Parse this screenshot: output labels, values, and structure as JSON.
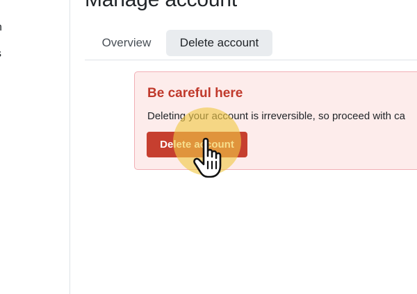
{
  "sidebar": {
    "items": [
      {
        "label": "n"
      },
      {
        "label": "s"
      }
    ]
  },
  "page": {
    "title": "Manage account"
  },
  "tabs": [
    {
      "label": "Overview",
      "active": false
    },
    {
      "label": "Delete account",
      "active": true
    }
  ],
  "danger_zone": {
    "title": "Be careful here",
    "message": "Deleting your account is irreversible, so proceed with ca",
    "button_label": "Delete account"
  },
  "pointer": {
    "icon": "hand-pointer-icon",
    "highlight_color": "#f0c846"
  },
  "colors": {
    "danger": "#c63f2f",
    "danger_background": "#fdeceb",
    "danger_border": "#f1aeb5",
    "active_tab": "#e9ecef"
  }
}
